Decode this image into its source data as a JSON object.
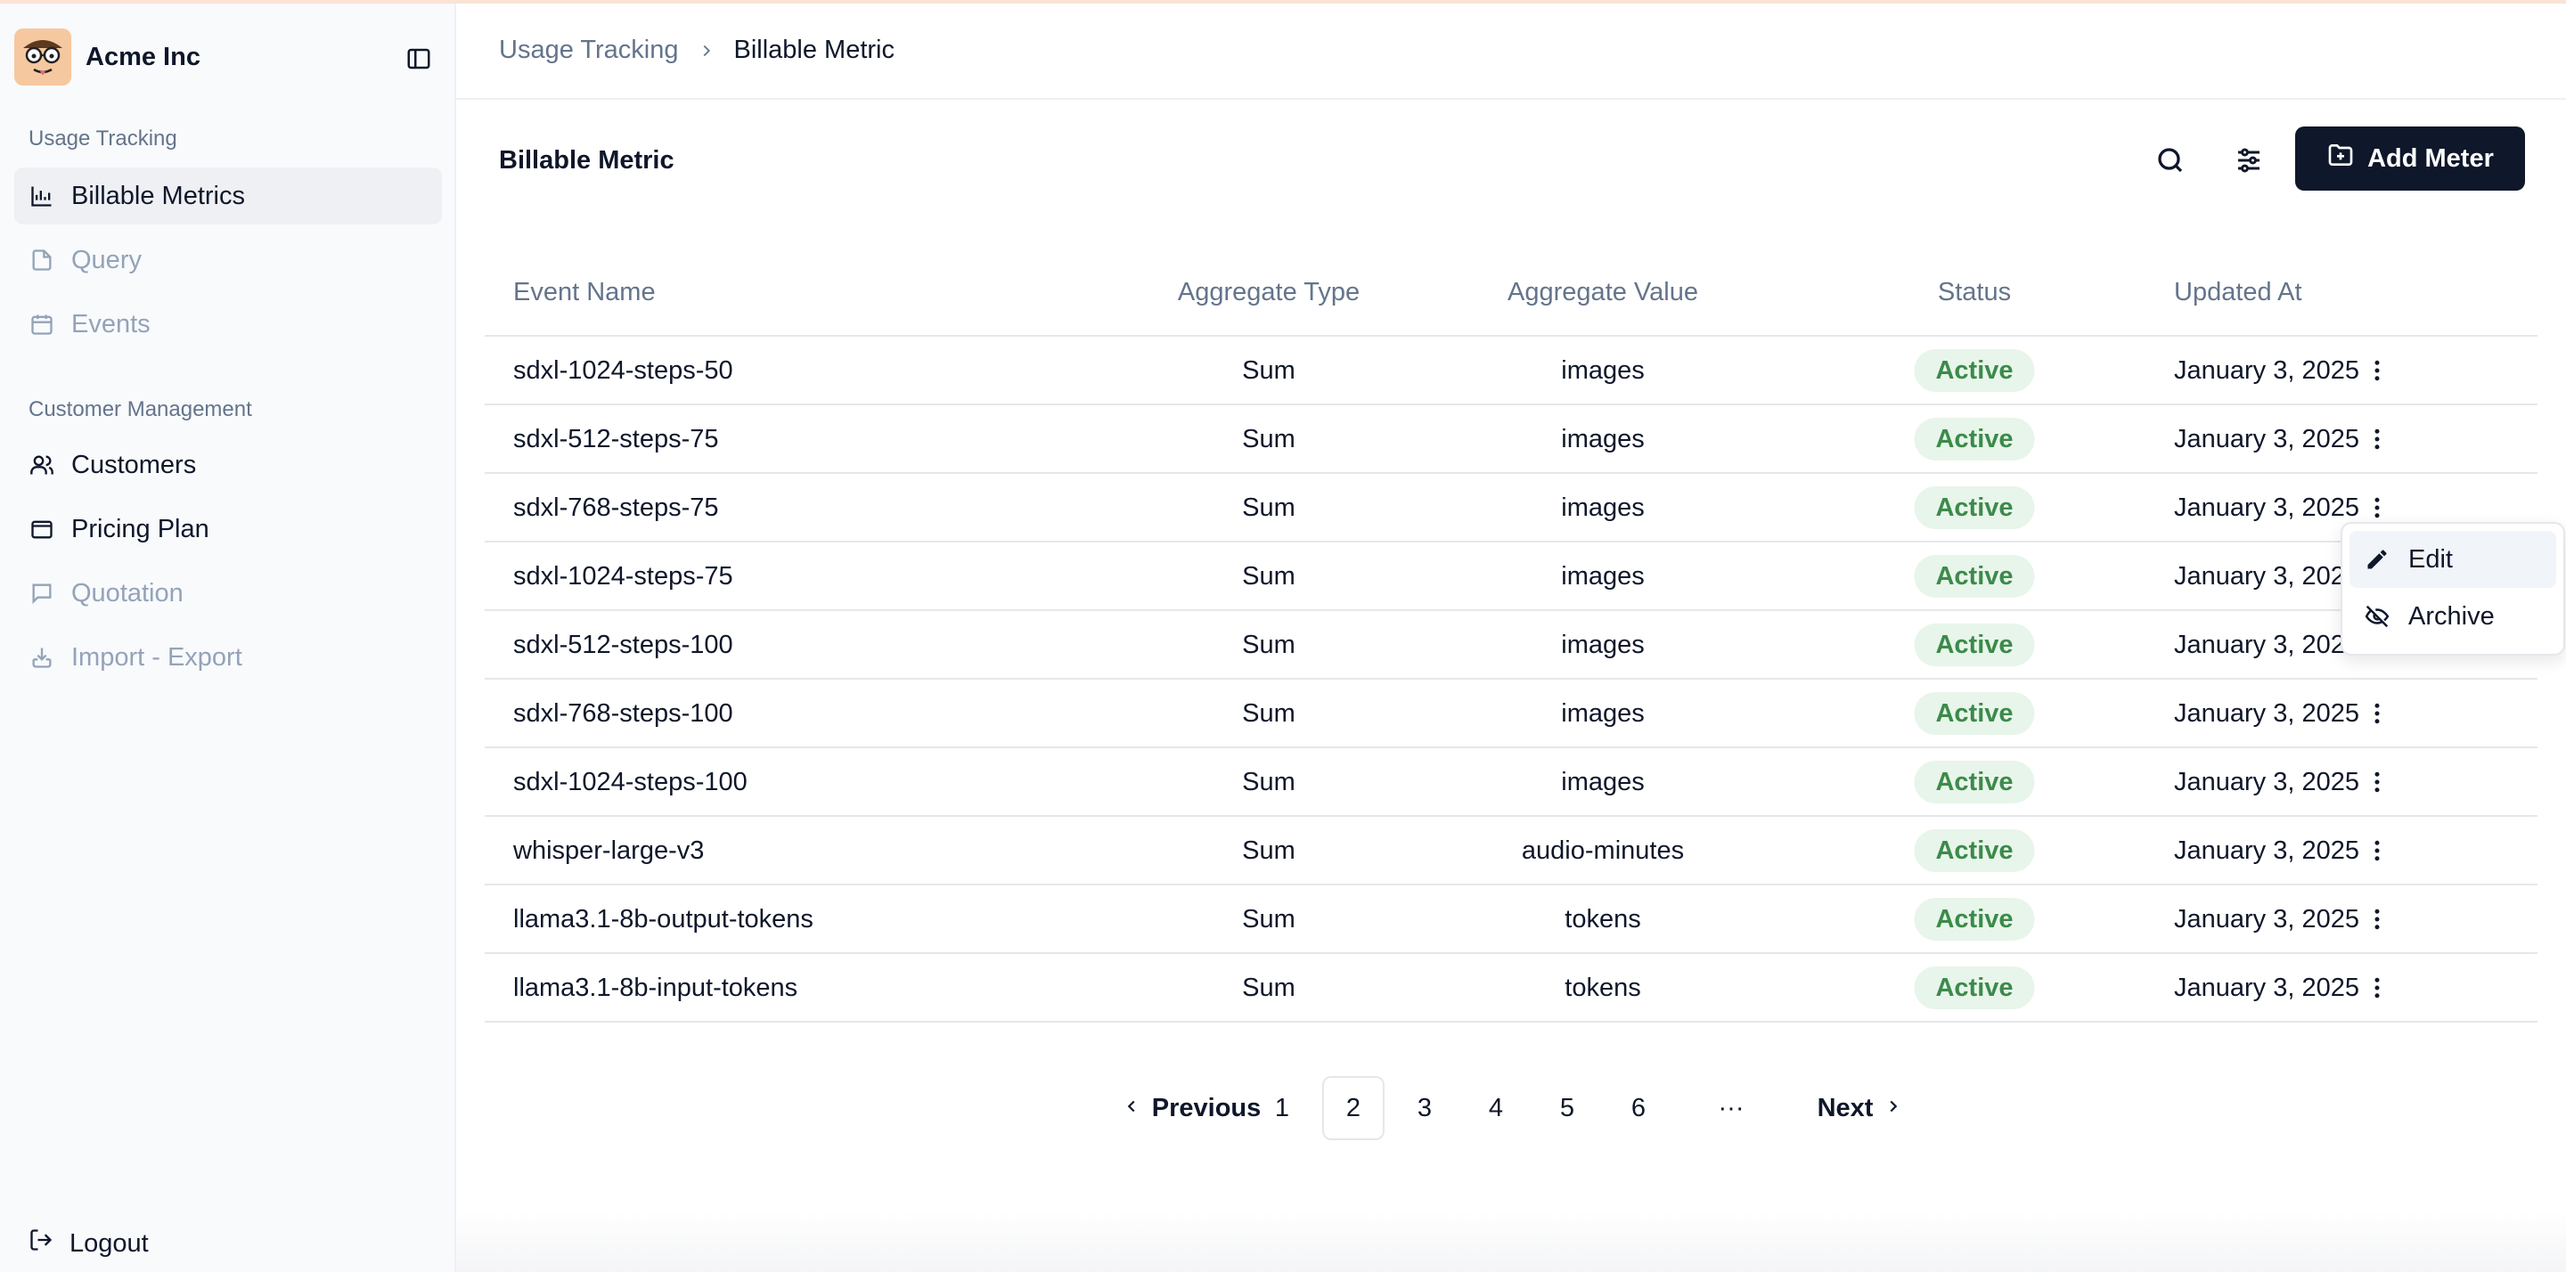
{
  "brand": {
    "name": "Acme Inc",
    "avatar_icon": "cartoon-face-avatar"
  },
  "sidebar": {
    "sections": [
      {
        "label": "Usage Tracking"
      },
      {
        "label": "Customer Management"
      }
    ],
    "items": [
      {
        "label": "Billable Metrics",
        "icon": "chart-icon",
        "state": "active"
      },
      {
        "label": "Query",
        "icon": "file-icon",
        "state": "disabled"
      },
      {
        "label": "Events",
        "icon": "calendar-icon",
        "state": "disabled"
      },
      {
        "label": "Customers",
        "icon": "users-icon",
        "state": "enabled"
      },
      {
        "label": "Pricing Plan",
        "icon": "wallet-icon",
        "state": "enabled"
      },
      {
        "label": "Quotation",
        "icon": "message-icon",
        "state": "disabled"
      },
      {
        "label": "Import - Export",
        "icon": "import-icon",
        "state": "disabled"
      }
    ],
    "logout": "Logout"
  },
  "breadcrumb": {
    "parent": "Usage Tracking",
    "current": "Billable Metric"
  },
  "page": {
    "title": "Billable Metric",
    "add_button": "Add Meter"
  },
  "table": {
    "headers": {
      "name": "Event Name",
      "type": "Aggregate Type",
      "value": "Aggregate Value",
      "status": "Status",
      "updated": "Updated At"
    },
    "rows": [
      {
        "name": "sdxl-1024-steps-50",
        "type": "Sum",
        "value": "images",
        "status": "Active",
        "updated": "January 3, 2025"
      },
      {
        "name": "sdxl-512-steps-75",
        "type": "Sum",
        "value": "images",
        "status": "Active",
        "updated": "January 3, 2025"
      },
      {
        "name": "sdxl-768-steps-75",
        "type": "Sum",
        "value": "images",
        "status": "Active",
        "updated": "January 3, 2025"
      },
      {
        "name": "sdxl-1024-steps-75",
        "type": "Sum",
        "value": "images",
        "status": "Active",
        "updated": "January 3, 2025"
      },
      {
        "name": "sdxl-512-steps-100",
        "type": "Sum",
        "value": "images",
        "status": "Active",
        "updated": "January 3, 2025"
      },
      {
        "name": "sdxl-768-steps-100",
        "type": "Sum",
        "value": "images",
        "status": "Active",
        "updated": "January 3, 2025"
      },
      {
        "name": "sdxl-1024-steps-100",
        "type": "Sum",
        "value": "images",
        "status": "Active",
        "updated": "January 3, 2025"
      },
      {
        "name": "whisper-large-v3",
        "type": "Sum",
        "value": "audio-minutes",
        "status": "Active",
        "updated": "January 3, 2025"
      },
      {
        "name": "llama3.1-8b-output-tokens",
        "type": "Sum",
        "value": "tokens",
        "status": "Active",
        "updated": "January 3, 2025"
      },
      {
        "name": "llama3.1-8b-input-tokens",
        "type": "Sum",
        "value": "tokens",
        "status": "Active",
        "updated": "January 3, 2025"
      }
    ]
  },
  "row_menu": {
    "open_row": 3,
    "items": [
      {
        "label": "Edit",
        "icon": "pencil-icon"
      },
      {
        "label": "Archive",
        "icon": "eye-off-icon"
      }
    ]
  },
  "pagination": {
    "previous": "Previous",
    "next": "Next",
    "pages": [
      "1",
      "2",
      "3",
      "4",
      "5",
      "6"
    ],
    "current": "2",
    "ellipsis": "···"
  },
  "colors": {
    "primary": "#0f172a",
    "status_bg": "#e8f5ea",
    "status_text": "#3c8a4b",
    "muted": "#64748b"
  }
}
